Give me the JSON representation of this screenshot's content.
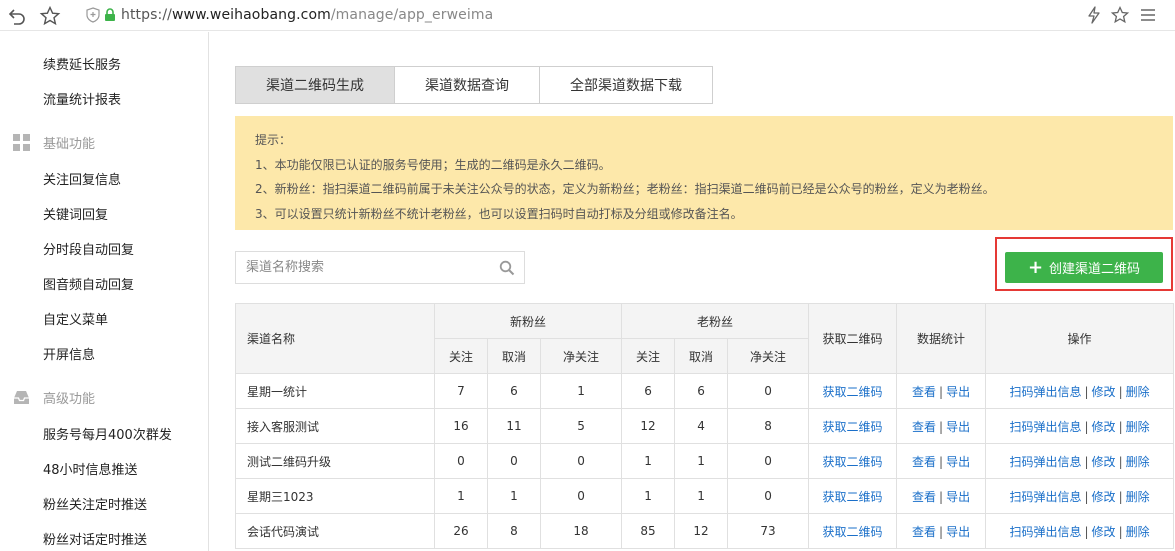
{
  "browser": {
    "url_scheme": "https://",
    "url_host": "www.weihaobang.com",
    "url_path": "/manage/app_erweima"
  },
  "sidebar": {
    "top_items": [
      "续费延长服务",
      "流量统计报表"
    ],
    "basic_section": "基础功能",
    "basic_items": [
      "关注回复信息",
      "关键词回复",
      "分时段自动回复",
      "图音频自动回复",
      "自定义菜单",
      "开屏信息"
    ],
    "advanced_section": "高级功能",
    "advanced_items": [
      "服务号每月400次群发",
      "48小时信息推送",
      "粉丝关注定时推送",
      "粉丝对话定时推送"
    ]
  },
  "tabs": [
    {
      "label": "渠道二维码生成",
      "active": true
    },
    {
      "label": "渠道数据查询",
      "active": false
    },
    {
      "label": "全部渠道数据下载",
      "active": false
    }
  ],
  "notice": {
    "title": "提示：",
    "lines": [
      "1、本功能仅限已认证的服务号使用；生成的二维码是永久二维码。",
      "2、新粉丝：指扫渠道二维码前属于未关注公众号的状态，定义为新粉丝；老粉丝：指扫渠道二维码前已经是公众号的粉丝，定义为老粉丝。",
      "3、可以设置只统计新粉丝不统计老粉丝，也可以设置扫码时自动打标及分组或修改备注名。"
    ]
  },
  "search": {
    "placeholder": "渠道名称搜索"
  },
  "create_button": {
    "label": "创建渠道二维码"
  },
  "table": {
    "headers": {
      "name": "渠道名称",
      "new_fans": "新粉丝",
      "old_fans": "老粉丝",
      "follow": "关注",
      "cancel": "取消",
      "net": "净关注",
      "qr": "获取二维码",
      "stats": "数据统计",
      "ops": "操作"
    },
    "link_labels": {
      "qr": "获取二维码",
      "view": "查看",
      "export": "导出",
      "popup": "扫码弹出信息",
      "edit": "修改",
      "delete": "删除",
      "sep": "|"
    },
    "rows": [
      {
        "name": "星期一统计",
        "nf": "7",
        "nc": "6",
        "nn": "1",
        "of": "6",
        "oc": "6",
        "on": "0"
      },
      {
        "name": "接入客服测试",
        "nf": "16",
        "nc": "11",
        "nn": "5",
        "of": "12",
        "oc": "4",
        "on": "8"
      },
      {
        "name": "测试二维码升级",
        "nf": "0",
        "nc": "0",
        "nn": "0",
        "of": "1",
        "oc": "1",
        "on": "0"
      },
      {
        "name": "星期三1023",
        "nf": "1",
        "nc": "1",
        "nn": "0",
        "of": "1",
        "oc": "1",
        "on": "0"
      },
      {
        "name": "会话代码演试",
        "nf": "26",
        "nc": "8",
        "nn": "18",
        "of": "85",
        "oc": "12",
        "on": "73"
      }
    ]
  },
  "colors": {
    "accent_green": "#3db34a",
    "notice_bg": "#fde8aa",
    "link_blue": "#1a6fc9",
    "highlight_red": "#e53935"
  }
}
